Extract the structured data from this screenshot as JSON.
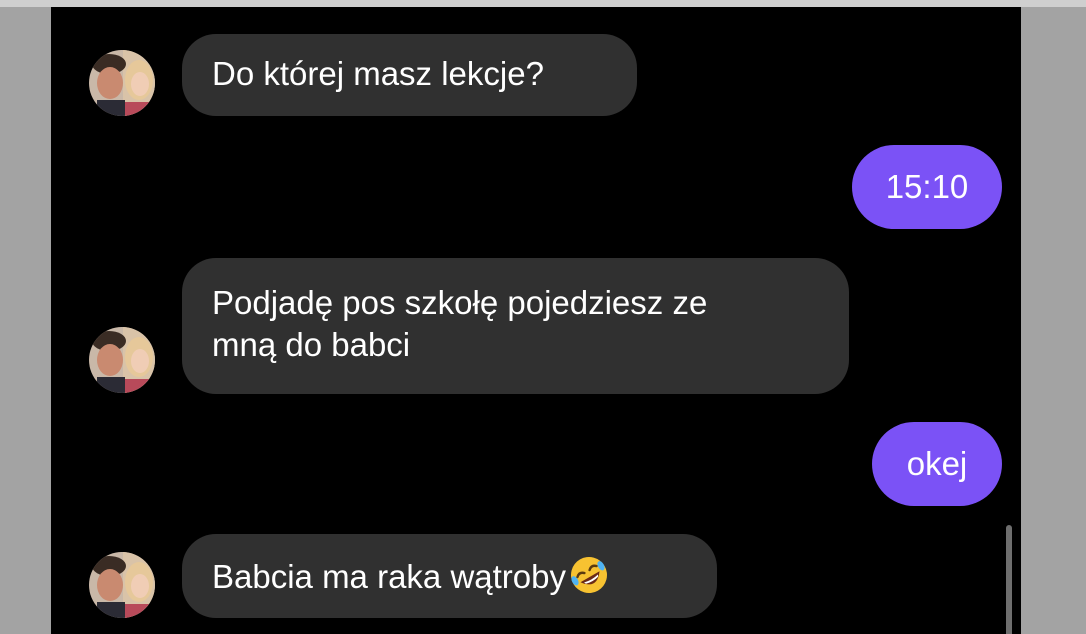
{
  "messages": [
    {
      "sender": "contact",
      "text": "Do której masz lekcje?"
    },
    {
      "sender": "me",
      "text": "15:10"
    },
    {
      "sender": "contact",
      "line1": "Podjadę pos szkołę pojedziesz ze",
      "line2": "mną do babci"
    },
    {
      "sender": "me",
      "text": "okej"
    },
    {
      "sender": "contact",
      "text": "Babcia ma raka wątroby",
      "emoji": "rolling-on-the-floor-laughing-emoji"
    }
  ],
  "colors": {
    "background": "#000000",
    "incoming_bubble": "#303030",
    "outgoing_bubble": "#7b52f6",
    "text": "#ffffff"
  },
  "icons": {
    "avatar": "contact-avatar-photo"
  }
}
